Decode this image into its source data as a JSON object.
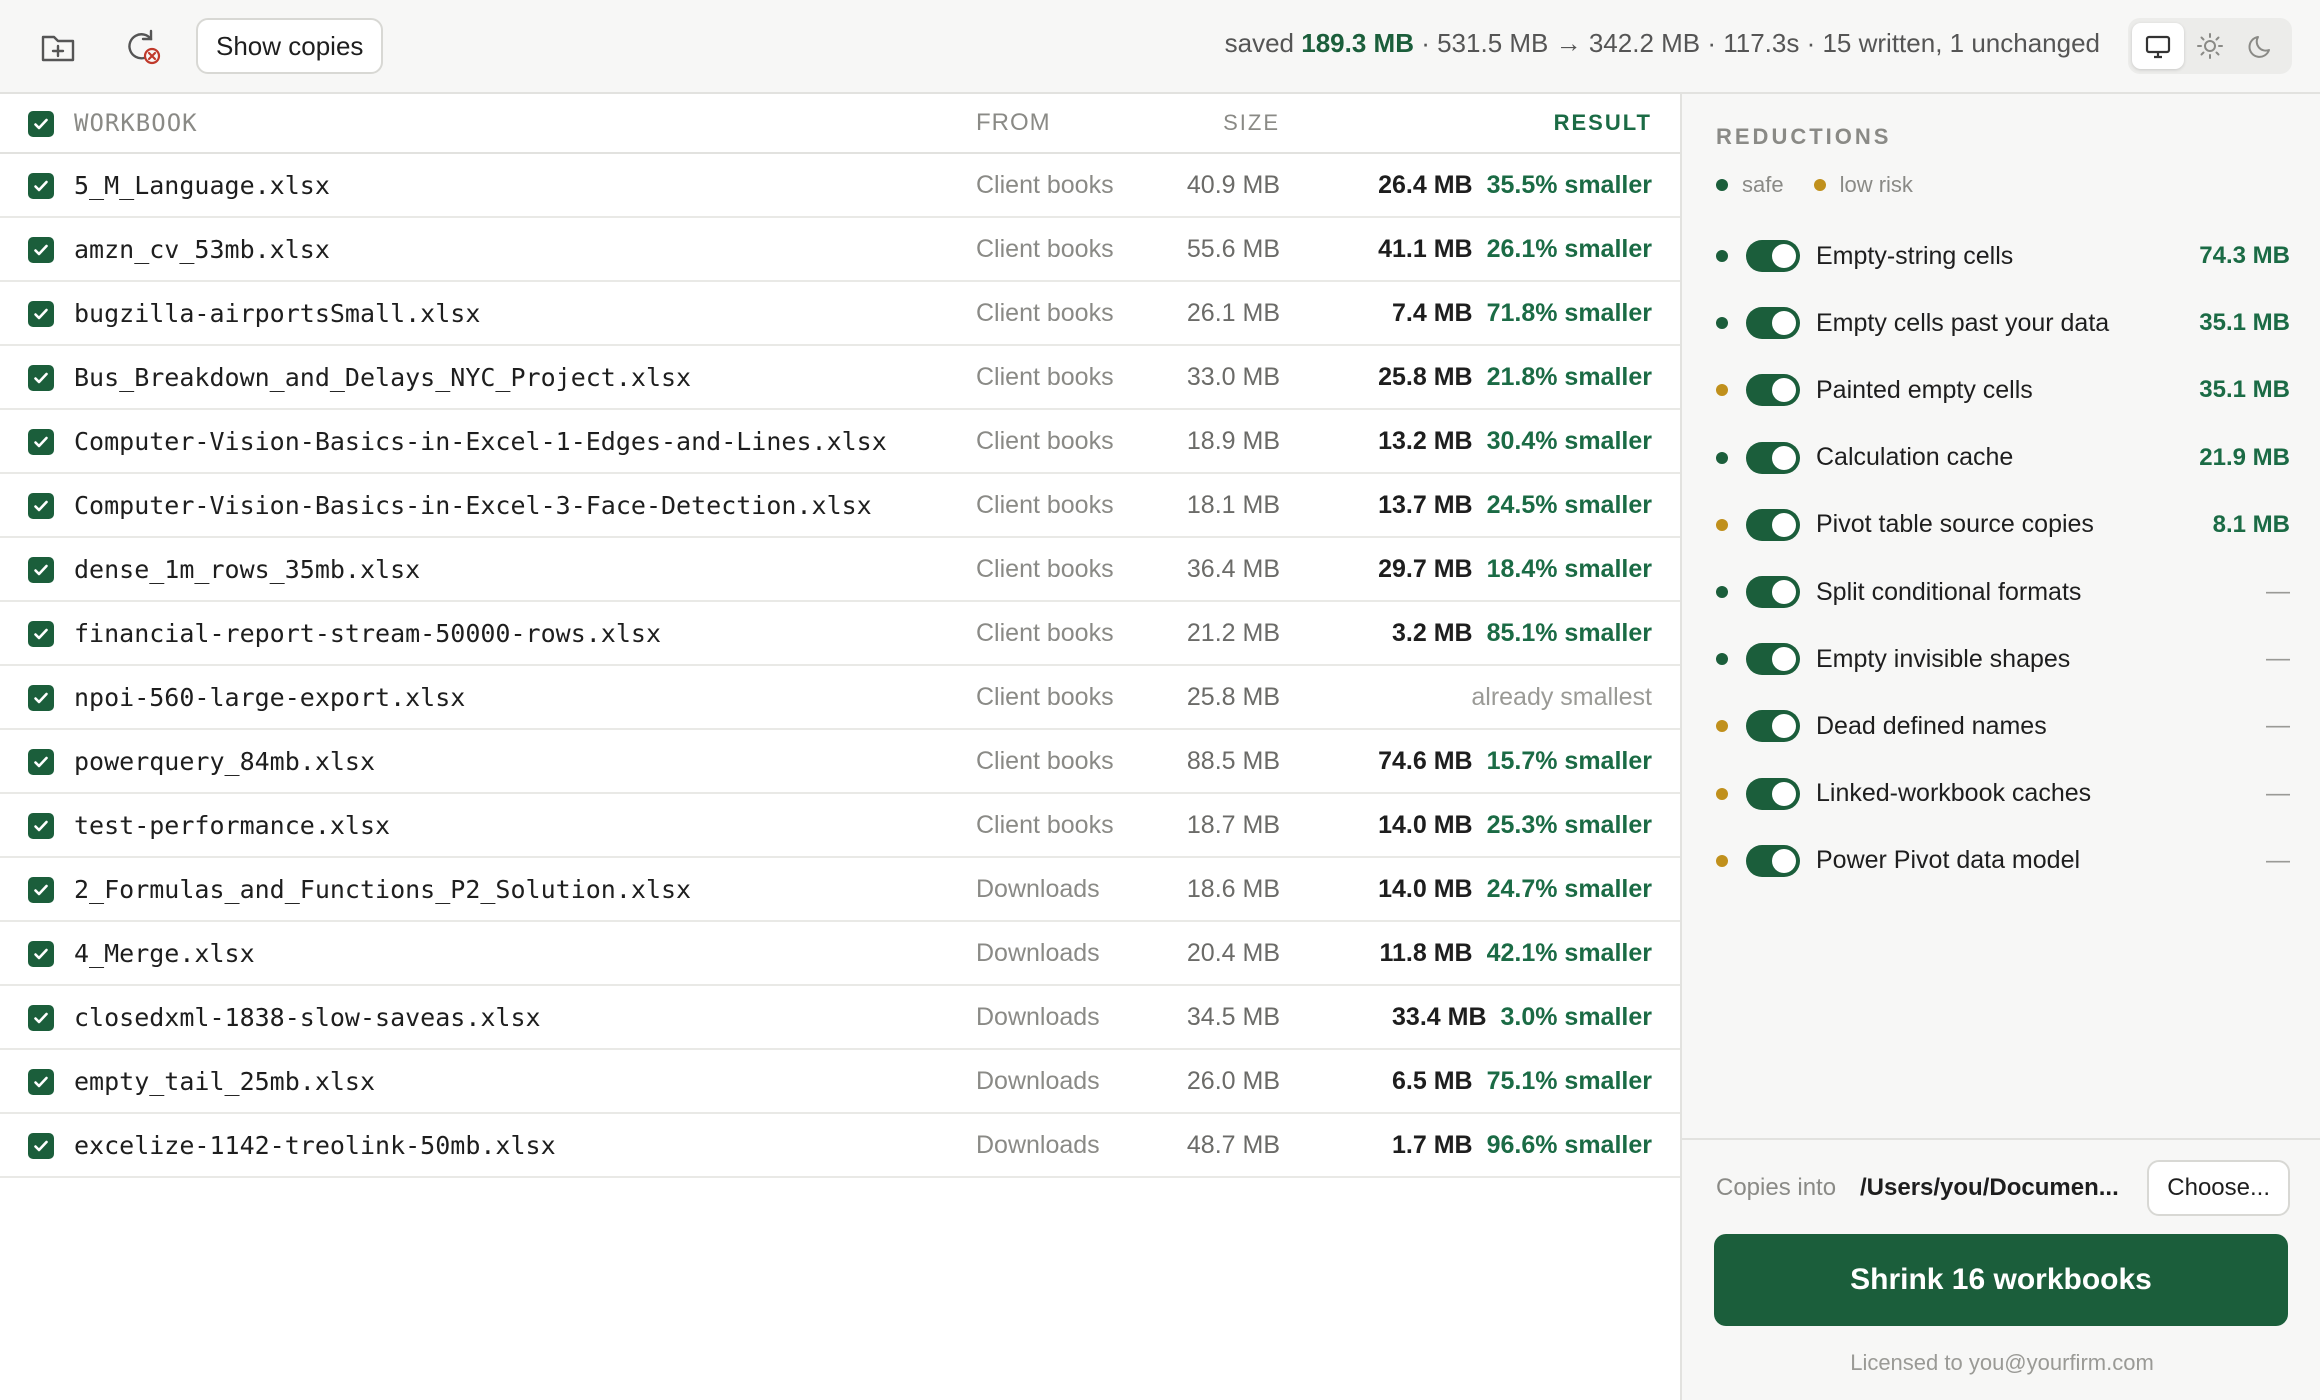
{
  "colors": {
    "accent": "#1b5e3b",
    "accent_text": "#1b6b45",
    "safe": "#1b5e3b",
    "low_risk": "#c0901c"
  },
  "toolbar": {
    "show_copies_label": "Show copies",
    "stats": {
      "saved_prefix": "saved",
      "saved_value": "189.3 MB",
      "rest": "· 531.5 MB → 342.2 MB · 117.3s · 15 written, 1 unchanged"
    },
    "icons": [
      "add-folder-icon",
      "refresh-clear-icon"
    ],
    "theme_options": [
      "system",
      "light",
      "dark"
    ],
    "theme_selected": "system"
  },
  "table": {
    "headers": {
      "name": "WORKBOOK",
      "from": "FROM",
      "size": "SIZE",
      "result": "RESULT"
    },
    "rows": [
      {
        "name": "5_M_Language.xlsx",
        "from": "Client books",
        "size": "40.9 MB",
        "new_size": "26.4 MB",
        "pct": "35.5% smaller",
        "note": ""
      },
      {
        "name": "amzn_cv_53mb.xlsx",
        "from": "Client books",
        "size": "55.6 MB",
        "new_size": "41.1 MB",
        "pct": "26.1% smaller",
        "note": ""
      },
      {
        "name": "bugzilla-airportsSmall.xlsx",
        "from": "Client books",
        "size": "26.1 MB",
        "new_size": "7.4 MB",
        "pct": "71.8% smaller",
        "note": ""
      },
      {
        "name": "Bus_Breakdown_and_Delays_NYC_Project.xlsx",
        "from": "Client books",
        "size": "33.0 MB",
        "new_size": "25.8 MB",
        "pct": "21.8% smaller",
        "note": ""
      },
      {
        "name": "Computer-Vision-Basics-in-Excel-1-Edges-and-Lines.xlsx",
        "from": "Client books",
        "size": "18.9 MB",
        "new_size": "13.2 MB",
        "pct": "30.4% smaller",
        "note": ""
      },
      {
        "name": "Computer-Vision-Basics-in-Excel-3-Face-Detection.xlsx",
        "from": "Client books",
        "size": "18.1 MB",
        "new_size": "13.7 MB",
        "pct": "24.5% smaller",
        "note": ""
      },
      {
        "name": "dense_1m_rows_35mb.xlsx",
        "from": "Client books",
        "size": "36.4 MB",
        "new_size": "29.7 MB",
        "pct": "18.4% smaller",
        "note": ""
      },
      {
        "name": "financial-report-stream-50000-rows.xlsx",
        "from": "Client books",
        "size": "21.2 MB",
        "new_size": "3.2 MB",
        "pct": "85.1% smaller",
        "note": ""
      },
      {
        "name": "npoi-560-large-export.xlsx",
        "from": "Client books",
        "size": "25.8 MB",
        "new_size": "",
        "pct": "",
        "note": "already smallest"
      },
      {
        "name": "powerquery_84mb.xlsx",
        "from": "Client books",
        "size": "88.5 MB",
        "new_size": "74.6 MB",
        "pct": "15.7% smaller",
        "note": ""
      },
      {
        "name": "test-performance.xlsx",
        "from": "Client books",
        "size": "18.7 MB",
        "new_size": "14.0 MB",
        "pct": "25.3% smaller",
        "note": ""
      },
      {
        "name": "2_Formulas_and_Functions_P2_Solution.xlsx",
        "from": "Downloads",
        "size": "18.6 MB",
        "new_size": "14.0 MB",
        "pct": "24.7% smaller",
        "note": ""
      },
      {
        "name": "4_Merge.xlsx",
        "from": "Downloads",
        "size": "20.4 MB",
        "new_size": "11.8 MB",
        "pct": "42.1% smaller",
        "note": ""
      },
      {
        "name": "closedxml-1838-slow-saveas.xlsx",
        "from": "Downloads",
        "size": "34.5 MB",
        "new_size": "33.4 MB",
        "pct": "3.0% smaller",
        "note": ""
      },
      {
        "name": "empty_tail_25mb.xlsx",
        "from": "Downloads",
        "size": "26.0 MB",
        "new_size": "6.5 MB",
        "pct": "75.1% smaller",
        "note": ""
      },
      {
        "name": "excelize-1142-treolink-50mb.xlsx",
        "from": "Downloads",
        "size": "48.7 MB",
        "new_size": "1.7 MB",
        "pct": "96.6% smaller",
        "note": ""
      }
    ]
  },
  "sidebar": {
    "title": "REDUCTIONS",
    "legend": {
      "safe": "safe",
      "low_risk": "low risk"
    },
    "reductions": [
      {
        "label": "Empty-string cells",
        "risk": "safe",
        "value": "74.3 MB",
        "enabled": true
      },
      {
        "label": "Empty cells past your data",
        "risk": "safe",
        "value": "35.1 MB",
        "enabled": true
      },
      {
        "label": "Painted empty cells",
        "risk": "low_risk",
        "value": "35.1 MB",
        "enabled": true
      },
      {
        "label": "Calculation cache",
        "risk": "safe",
        "value": "21.9 MB",
        "enabled": true
      },
      {
        "label": "Pivot table source copies",
        "risk": "low_risk",
        "value": "8.1 MB",
        "enabled": true
      },
      {
        "label": "Split conditional formats",
        "risk": "safe",
        "value": "—",
        "enabled": true
      },
      {
        "label": "Empty invisible shapes",
        "risk": "safe",
        "value": "—",
        "enabled": true
      },
      {
        "label": "Dead defined names",
        "risk": "low_risk",
        "value": "—",
        "enabled": true
      },
      {
        "label": "Linked-workbook caches",
        "risk": "low_risk",
        "value": "—",
        "enabled": true
      },
      {
        "label": "Power Pivot data model",
        "risk": "low_risk",
        "value": "—",
        "enabled": true
      }
    ],
    "footer": {
      "copies_label": "Copies into",
      "copies_path": "/Users/you/Documen...",
      "choose_label": "Choose...",
      "shrink_label": "Shrink 16 workbooks",
      "license": "Licensed to you@yourfirm.com"
    }
  }
}
